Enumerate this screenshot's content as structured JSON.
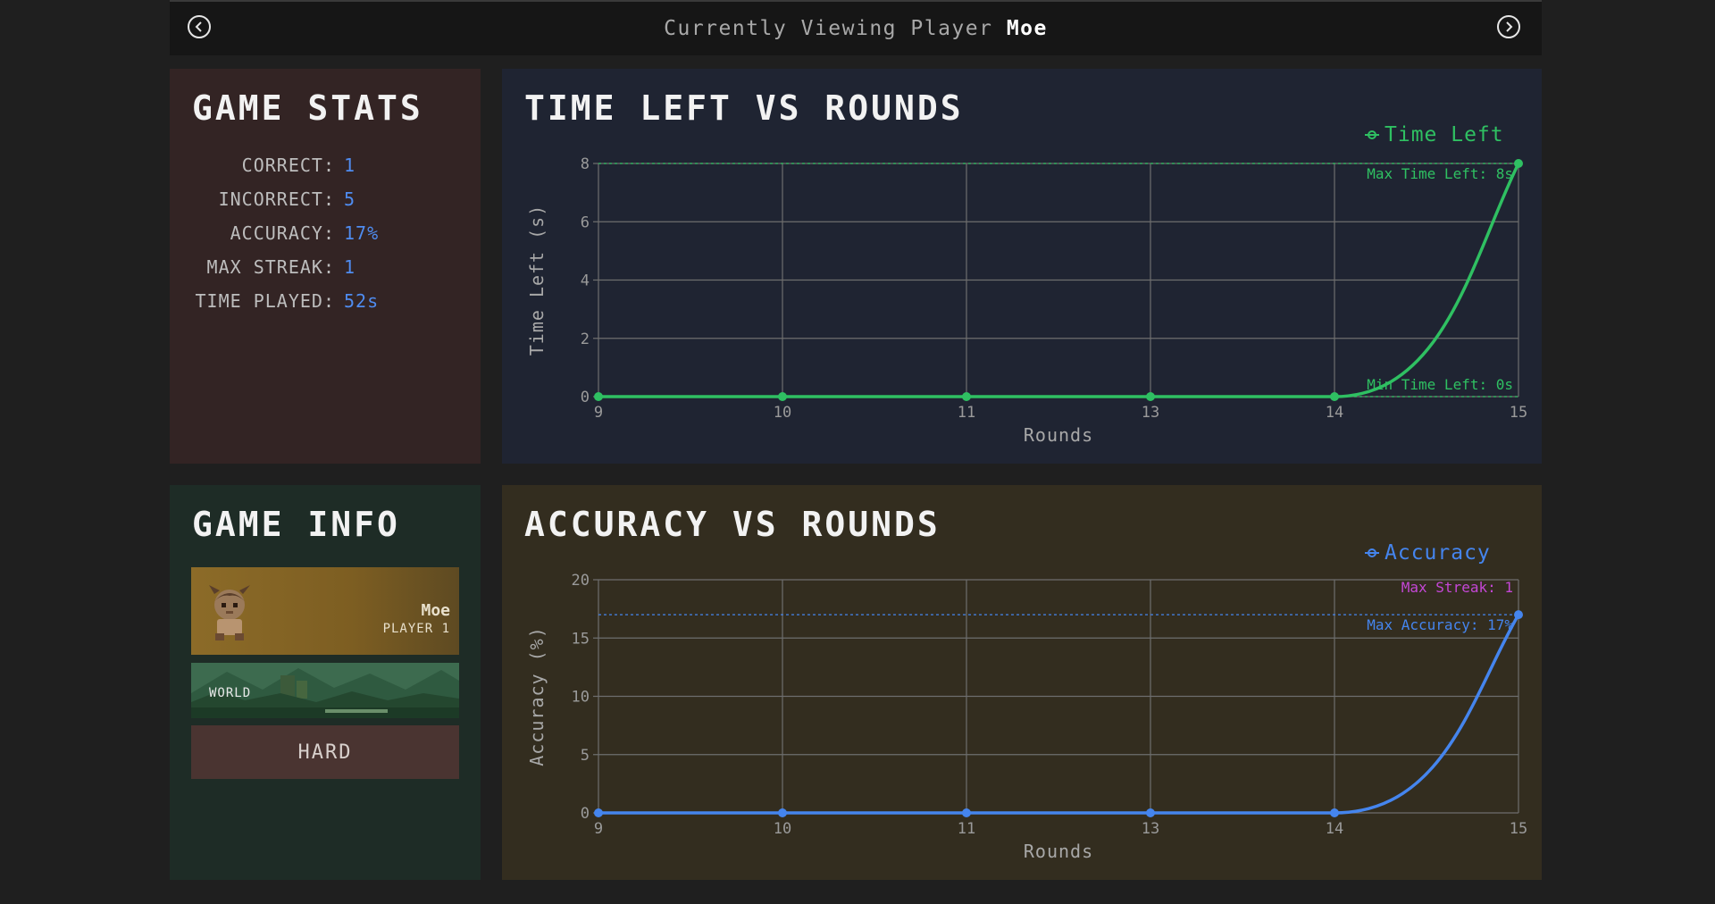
{
  "header": {
    "prefix": "Currently Viewing Player",
    "player": "Moe"
  },
  "stats": {
    "title": "GAME STATS",
    "rows": [
      {
        "label": "CORRECT:",
        "value": "1"
      },
      {
        "label": "INCORRECT:",
        "value": "5"
      },
      {
        "label": "ACCURACY:",
        "value": "17%"
      },
      {
        "label": "MAX STREAK:",
        "value": "1"
      },
      {
        "label": "TIME PLAYED:",
        "value": "52s"
      }
    ]
  },
  "info": {
    "title": "GAME INFO",
    "player_name": "Moe",
    "player_label": "PLAYER 1",
    "world_label": "WORLD",
    "difficulty": "HARD"
  },
  "chart_data": [
    {
      "type": "line",
      "title": "TIME LEFT VS ROUNDS",
      "xlabel": "Rounds",
      "ylabel": "Time Left (s)",
      "categories": [
        "9",
        "10",
        "11",
        "13",
        "14",
        "15"
      ],
      "ylim": [
        0,
        8
      ],
      "yticks": [
        0,
        2,
        4,
        6,
        8
      ],
      "grid": true,
      "legend": "top-right",
      "color": "#2fc062",
      "series": [
        {
          "name": "Time Left",
          "values": [
            0,
            0,
            0,
            0,
            0,
            8
          ]
        }
      ],
      "ref_lines": [
        {
          "value": 8,
          "label": "Max Time Left: 8s",
          "color": "#2fc062"
        },
        {
          "value": 0,
          "label": "Min Time Left: 0s",
          "color": "#2fc062"
        }
      ]
    },
    {
      "type": "line",
      "title": "ACCURACY VS ROUNDS",
      "xlabel": "Rounds",
      "ylabel": "Accuracy (%)",
      "categories": [
        "9",
        "10",
        "11",
        "13",
        "14",
        "15"
      ],
      "ylim": [
        0,
        20
      ],
      "yticks": [
        0,
        5,
        10,
        15,
        20
      ],
      "grid": true,
      "legend": "top-right",
      "color": "#4585ee",
      "series": [
        {
          "name": "Accuracy",
          "values": [
            0,
            0,
            0,
            0,
            0,
            17
          ]
        }
      ],
      "ref_lines": [
        {
          "value": 17,
          "label": "Max Accuracy: 17%",
          "color": "#4585ee"
        }
      ],
      "annotations": [
        {
          "label": "Max Streak: 1",
          "color": "#c447d6"
        }
      ]
    }
  ]
}
